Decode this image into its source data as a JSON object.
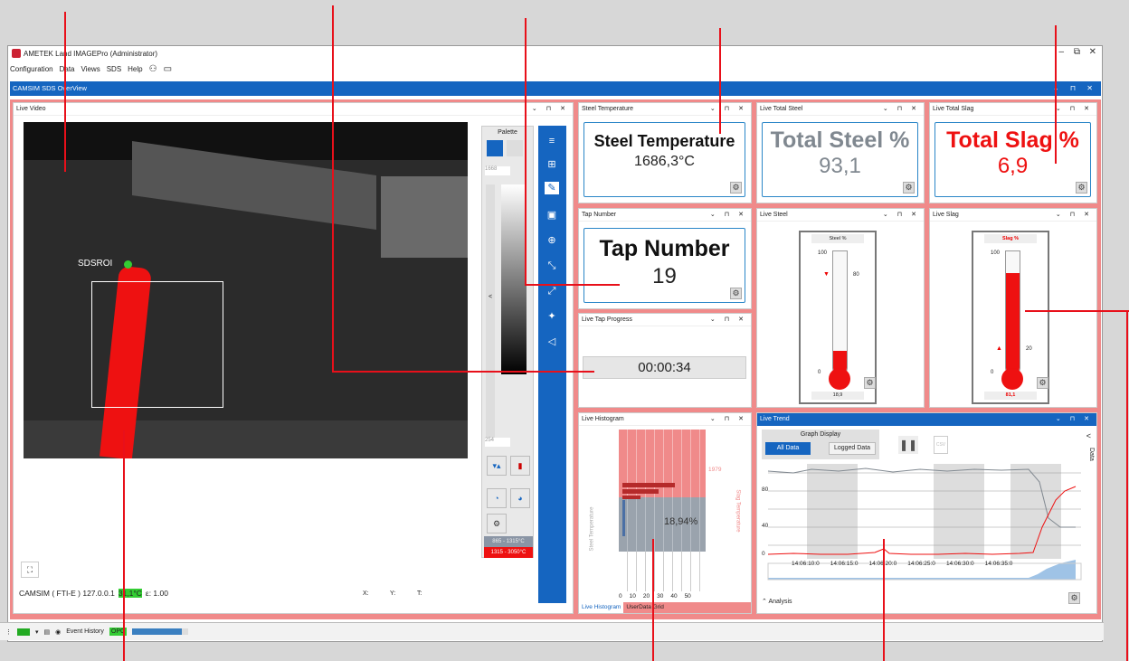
{
  "window": {
    "title": "AMETEK Land IMAGEPro (Administrator)",
    "min": "–",
    "max": "⧉",
    "close": "✕"
  },
  "menu": [
    "Configuration",
    "Data",
    "Views",
    "SDS",
    "Help"
  ],
  "sds_tab": {
    "title": "CAMSIM SDS OverView",
    "controls": "⌄ ⊓ ✕"
  },
  "panel_controls": "⌄ ⊓ ✕",
  "live_video": {
    "title": "Live Video",
    "roi_label": "SDSROI",
    "palette": {
      "title": "Palette",
      "top_value": "1668",
      "bottom_value": "254",
      "range_gray": "865 - 1315°C",
      "range_red": "1315 - 3050°C",
      "side_arrow": "<"
    },
    "status": {
      "camera": "CAMSIM ( FTI-E ) 127.0.0.1",
      "temp": "31,1°C",
      "emissivity": "ε: 1.00",
      "x": "X:",
      "y": "Y:",
      "t": "T:"
    }
  },
  "steel_temperature": {
    "title": "Steel Temperature",
    "heading": "Steel Temperature",
    "value": "1686,3°C"
  },
  "tap_number": {
    "title": "Tap Number",
    "heading": "Tap Number",
    "value": "19"
  },
  "tap_progress": {
    "title": "Live Tap Progress",
    "value": "00:00:34"
  },
  "total_steel": {
    "title": "Live Total Steel",
    "heading": "Total Steel %",
    "value": "93,1"
  },
  "total_slag": {
    "title": "Live Total Slag",
    "heading": "Total Slag %",
    "value": "6,9"
  },
  "live_steel": {
    "title": "Live Steel",
    "label": "Steel %",
    "max": "100",
    "min": "0",
    "marker": "80",
    "value": "18,9",
    "level": 0.189,
    "marker_level": 0.8
  },
  "live_slag": {
    "title": "Live Slag",
    "label": "Slag %",
    "max": "100",
    "min": "0",
    "marker": "20",
    "value": "81,1",
    "level": 0.811,
    "marker_level": 0.2
  },
  "histogram": {
    "title": "Live Histogram",
    "percent": "18,94%",
    "top_value": "1979",
    "ylabel_left": "Steel Temperature",
    "ylabel_right": "Slag Temperature",
    "xticks": [
      "0",
      "10",
      "20",
      "30",
      "40",
      "50"
    ],
    "tabs": [
      "Live Histogram",
      "UserData Grid"
    ]
  },
  "trend": {
    "title": "Live Trend",
    "graph_display": "Graph Display",
    "btn_all": "All Data",
    "btn_logged": "Logged Data",
    "side": "Data",
    "side_arrow": "<",
    "yticks": [
      "80",
      "40",
      "0"
    ],
    "xticks": [
      "14:06:10:0",
      "14:06:15:0",
      "14:06:20:0",
      "14:06:25:0",
      "14:06:30:0",
      "14:06:35:0"
    ],
    "analysis": "Analysis"
  },
  "taskbar": {
    "event_history": "Event History",
    "opc": "OPC"
  },
  "colors": {
    "accent": "#1565c0",
    "red": "#ee1111",
    "panel_bg": "#f08a8a",
    "steel_gray": "#808890"
  }
}
